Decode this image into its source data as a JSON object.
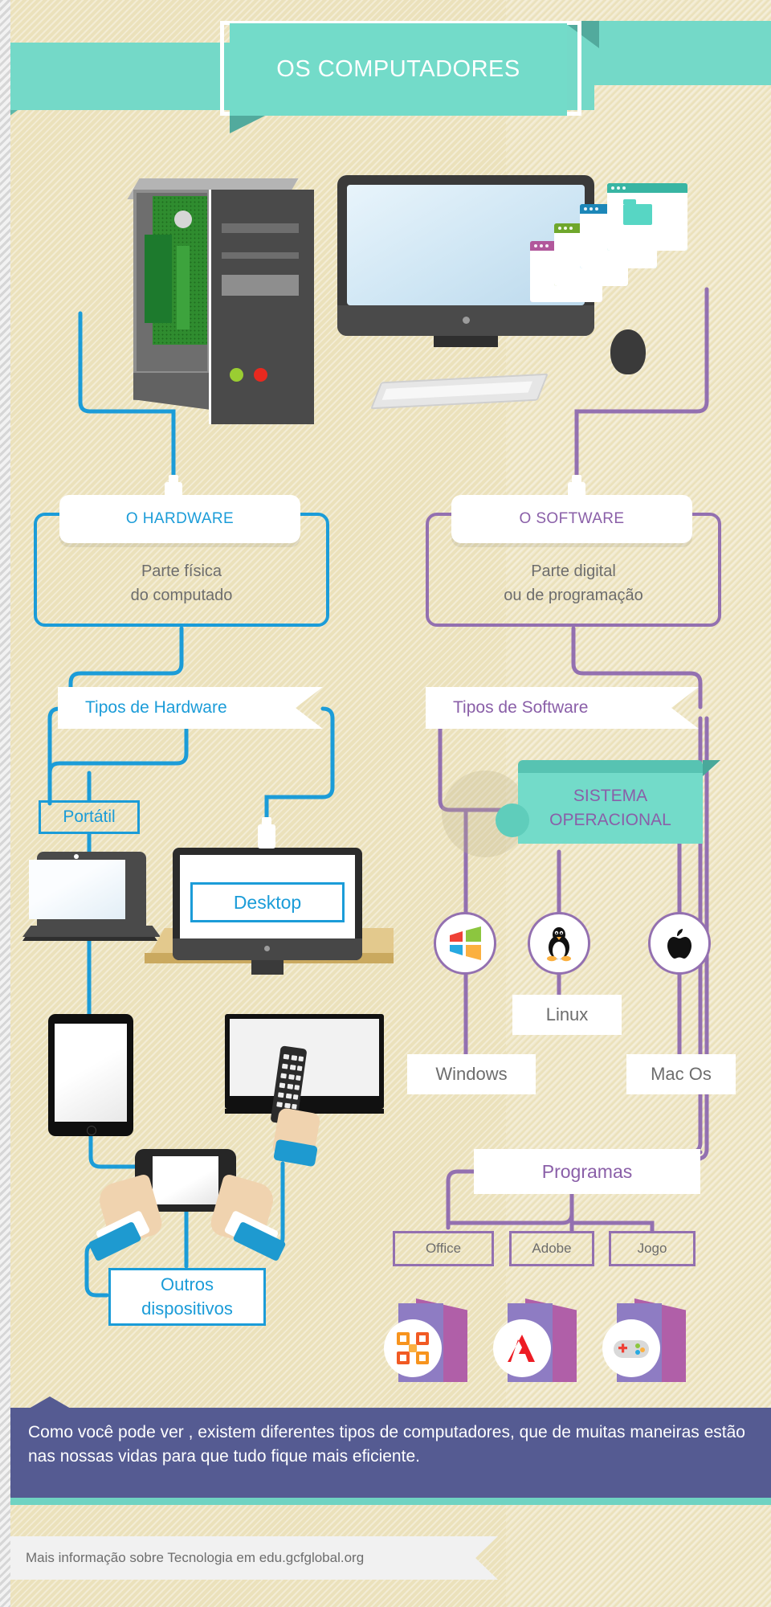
{
  "header": {
    "title": "OS COMPUTADORES"
  },
  "hardware": {
    "pill_label": "O HARDWARE",
    "sub_line1": "Parte física",
    "sub_line2": "do computado",
    "banner": "Tipos de Hardware",
    "types": {
      "portatil": "Portátil",
      "desktop": "Desktop",
      "outros_line1": "Outros",
      "outros_line2": "dispositivos"
    }
  },
  "software": {
    "pill_label": "O SOFTWARE",
    "sub_line1": "Parte digital",
    "sub_line2": "ou de programação",
    "banner": "Tipos de Software",
    "so_line1": "SISTEMA",
    "so_line2": "OPERACIONAL",
    "os_items": [
      {
        "label": "Windows",
        "icon": "windows-logo-icon"
      },
      {
        "label": "Linux",
        "icon": "linux-penguin-icon"
      },
      {
        "label": "Mac Os",
        "icon": "apple-logo-icon"
      }
    ],
    "programas_label": "Programas",
    "programas": [
      {
        "label": "Office",
        "icon": "office-logo-icon"
      },
      {
        "label": "Adobe",
        "icon": "adobe-logo-icon"
      },
      {
        "label": "Jogo",
        "icon": "gamepad-icon"
      }
    ]
  },
  "caption": {
    "text": "Como você pode ver , existem diferentes tipos de computadores, que de muitas maneiras estão nas nossas vidas para que tudo fique mais eficiente."
  },
  "footer": {
    "text": "Mais informação sobre Tecnologia em edu.gcfglobal.org"
  },
  "colors": {
    "teal": "#73dbc9",
    "blue": "#1b9cd8",
    "purple": "#8a5fa8",
    "purple_line": "#9370b0",
    "caption_bg": "#555b92",
    "paper": "#ebe1bb"
  }
}
